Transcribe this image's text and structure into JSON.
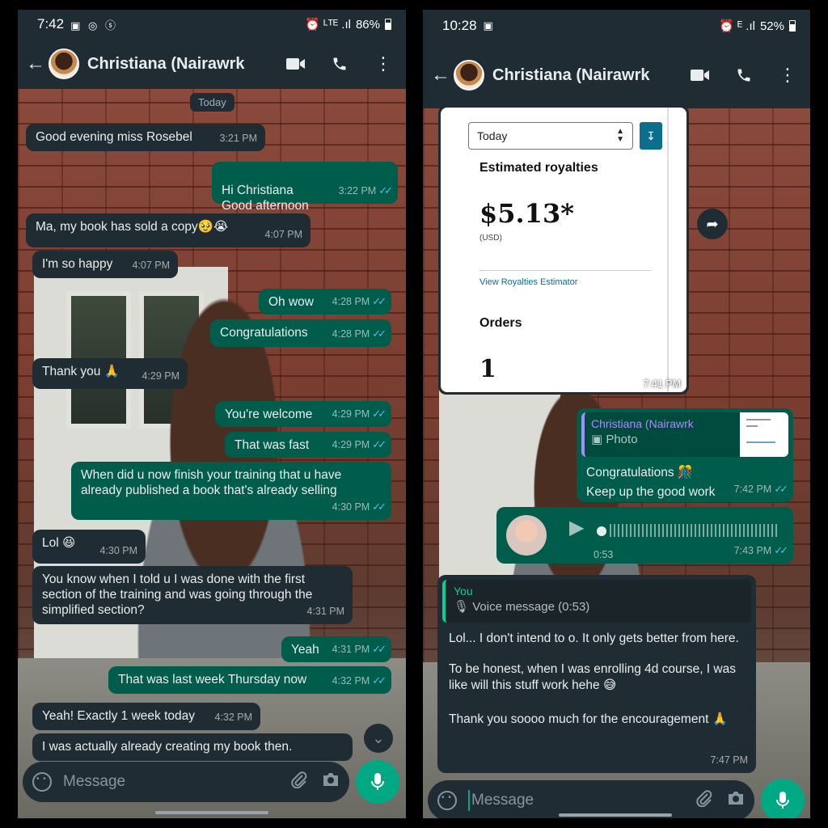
{
  "left": {
    "status": {
      "time": "7:42",
      "icons": "▣ ◎ ⓢ",
      "net": "⏰ ᴸᵀᴱ .ıl",
      "battery": "86%"
    },
    "appbar": {
      "title": "Christiana (Nairawrk"
    },
    "date_chip": "Today",
    "messages": [
      {
        "dir": "in",
        "text": "Good evening miss Rosebel",
        "time": "3:21 PM"
      },
      {
        "dir": "out",
        "text": "Hi Christiana\nGood afternoon",
        "time": "3:22 PM"
      },
      {
        "dir": "in",
        "text": "Ma, my book has sold a copy🥹😭",
        "time": "4:07 PM"
      },
      {
        "dir": "in",
        "text": "I'm so happy",
        "time": "4:07 PM"
      },
      {
        "dir": "out",
        "text": "Oh wow",
        "time": "4:28 PM"
      },
      {
        "dir": "out",
        "text": "Congratulations",
        "time": "4:28 PM"
      },
      {
        "dir": "in",
        "text": "Thank you 🙏",
        "time": "4:29 PM"
      },
      {
        "dir": "out",
        "text": "You're welcome",
        "time": "4:29 PM"
      },
      {
        "dir": "out",
        "text": "That was fast",
        "time": "4:29 PM"
      },
      {
        "dir": "out",
        "text": "When did u now finish your training that u have already published a book that's already selling",
        "time": "4:30 PM"
      },
      {
        "dir": "in",
        "text": "Lol 😆",
        "time": "4:30 PM"
      },
      {
        "dir": "in",
        "text": "You know when I told u I was done with the first section of the training and was going through the simplified section?",
        "time": "4:31 PM"
      },
      {
        "dir": "out",
        "text": "Yeah",
        "time": "4:31 PM"
      },
      {
        "dir": "out",
        "text": "That was last week Thursday now",
        "time": "4:32 PM"
      },
      {
        "dir": "in",
        "text": "Yeah! Exactly 1 week today",
        "time": "4:32 PM"
      },
      {
        "dir": "in",
        "text": "I was actually already creating my book then.",
        "time": ""
      }
    ],
    "composer": {
      "placeholder": "Message"
    }
  },
  "right": {
    "status": {
      "time": "10:28",
      "icons": "▣",
      "net": "⏰ ᴱ .ıl",
      "battery": "52%"
    },
    "appbar": {
      "title": "Christiana (Nairawrk"
    },
    "image": {
      "select": "Today",
      "label": "Estimated royalties",
      "amount": "$5.13*",
      "currency": "(USD)",
      "link": "View Royalties Estimator",
      "orders_label": "Orders",
      "orders_value": "1",
      "time": "7:41 PM"
    },
    "reply_photo": {
      "quote_name": "Christiana (Nairawrk",
      "quote_sub": "▣ Photo",
      "text": "Congratulations 🎊\nKeep up the good work",
      "time": "7:42 PM"
    },
    "voice": {
      "duration": "0:53",
      "time": "7:43 PM"
    },
    "reply_voice": {
      "quote_name": "You",
      "quote_sub": "🎙 Voice message (0:53)",
      "p1": "Lol... I don't intend to o. It only gets better from here.",
      "p2": "To be honest, when I was enrolling 4d course, I was like will this stuff work hehe 😅",
      "p3": "Thank you soooo much for the encouragement 🙏",
      "time": "7:47 PM"
    },
    "composer": {
      "placeholder": "Message"
    }
  },
  "colors": {
    "incoming": "#202c33",
    "outgoing": "#005c4b",
    "accent": "#00a884",
    "ticks": "#53bdeb"
  }
}
